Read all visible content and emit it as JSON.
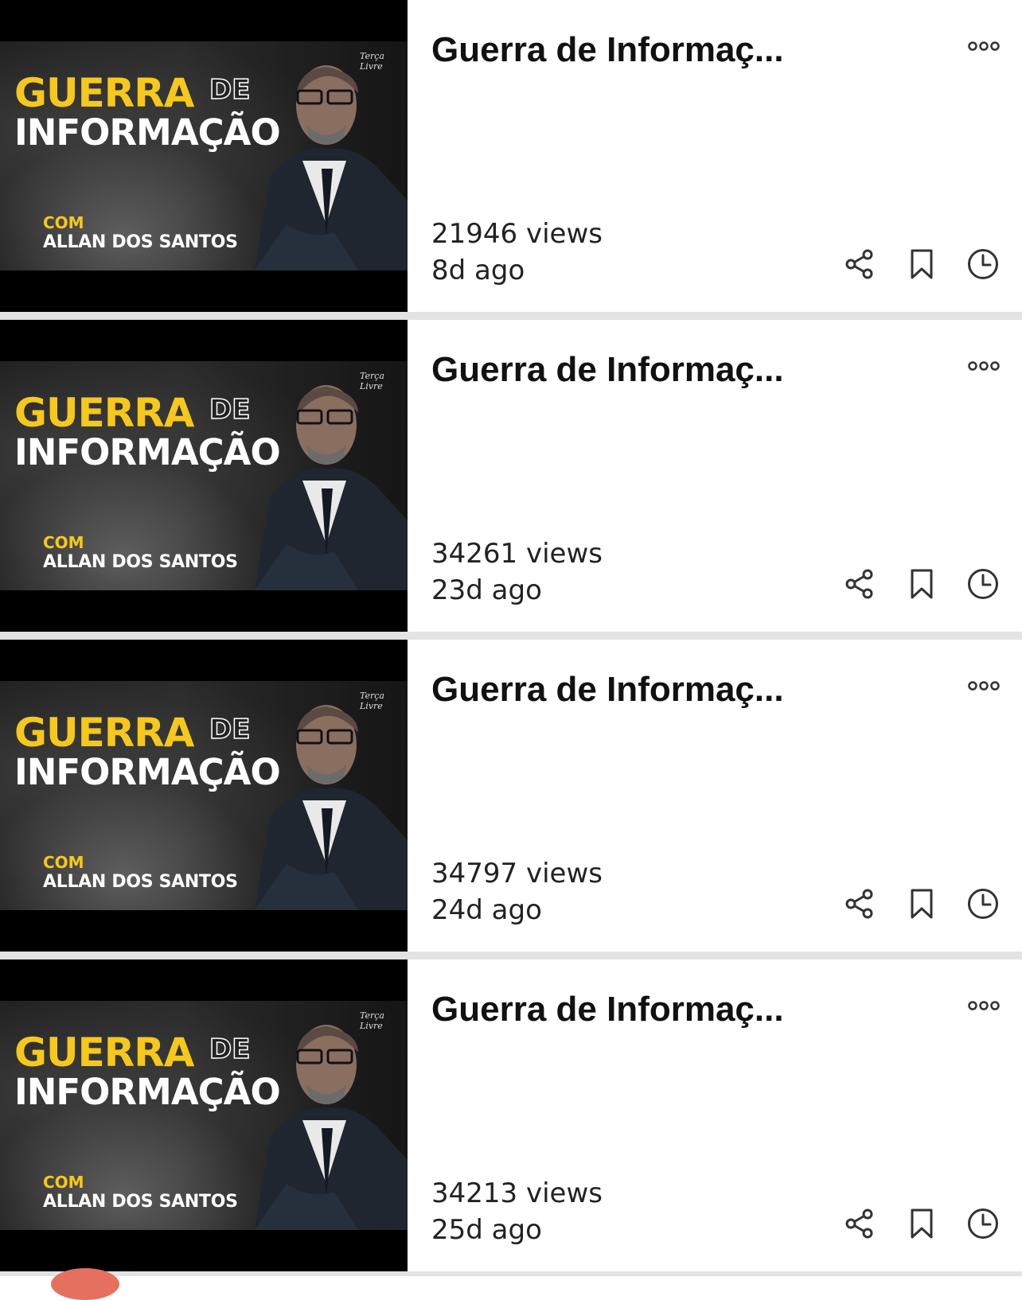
{
  "videos": [
    {
      "title": "Guerra de Informaç...",
      "views": "21946 views",
      "ago": "8d ago",
      "thumbnail": {
        "title_line1": "GUERRA",
        "title_de": "DE",
        "title_line2": "INFORMAÇÃO",
        "com": "COM",
        "host": "ALLAN DOS SANTOS"
      }
    },
    {
      "title": "Guerra de Informaç...",
      "views": "34261 views",
      "ago": "23d ago",
      "thumbnail": {
        "title_line1": "GUERRA",
        "title_de": "DE",
        "title_line2": "INFORMAÇÃO",
        "com": "COM",
        "host": "ALLAN DOS SANTOS"
      }
    },
    {
      "title": "Guerra de Informaç...",
      "views": "34797 views",
      "ago": "24d ago",
      "thumbnail": {
        "title_line1": "GUERRA",
        "title_de": "DE",
        "title_line2": "INFORMAÇÃO",
        "com": "COM",
        "host": "ALLAN DOS SANTOS"
      }
    },
    {
      "title": "Guerra de Informaç...",
      "views": "34213 views",
      "ago": "25d ago",
      "thumbnail": {
        "title_line1": "GUERRA",
        "title_de": "DE",
        "title_line2": "INFORMAÇÃO",
        "com": "COM",
        "host": "ALLAN DOS SANTOS"
      }
    }
  ],
  "icons": {
    "more": "more-horizontal-icon",
    "share": "share-icon",
    "save": "bookmark-icon",
    "watch_later": "clock-icon"
  },
  "colors": {
    "background": "#ffffff",
    "separator": "#e3e3e3",
    "thumbnail_accent": "#f6c81b",
    "text": "#111111",
    "icon": "#333333"
  }
}
